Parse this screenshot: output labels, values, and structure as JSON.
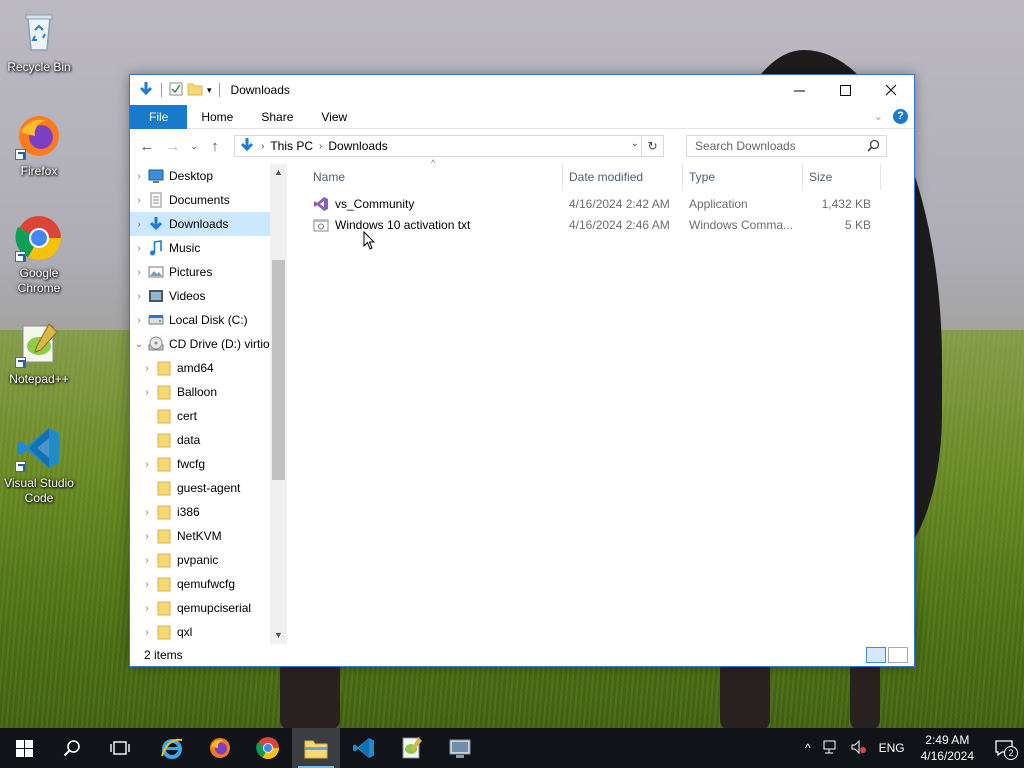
{
  "desktop": {
    "icons": [
      {
        "label": "Recycle Bin"
      },
      {
        "label": "Firefox"
      },
      {
        "label": "Google Chrome"
      },
      {
        "label": "Notepad++"
      },
      {
        "label": "Visual Studio Code"
      }
    ]
  },
  "window": {
    "title": "Downloads",
    "ribbon_tabs": [
      "File",
      "Home",
      "Share",
      "View"
    ],
    "breadcrumb": [
      "This PC",
      "Downloads"
    ],
    "search_placeholder": "Search Downloads",
    "nav_items": [
      {
        "label": "Desktop",
        "icon": "desktop-icon"
      },
      {
        "label": "Documents",
        "icon": "documents-icon"
      },
      {
        "label": "Downloads",
        "icon": "download-arrow-icon",
        "selected": true
      },
      {
        "label": "Music",
        "icon": "music-note-icon"
      },
      {
        "label": "Pictures",
        "icon": "pictures-icon"
      },
      {
        "label": "Videos",
        "icon": "videos-icon"
      },
      {
        "label": "Local Disk (C:)",
        "icon": "drive-icon"
      },
      {
        "label": "CD Drive (D:) virtio-win",
        "icon": "cd-drive-icon",
        "expanded": true
      },
      {
        "label": "amd64",
        "icon": "folder-icon"
      },
      {
        "label": "Balloon",
        "icon": "folder-icon"
      },
      {
        "label": "cert",
        "icon": "folder-icon"
      },
      {
        "label": "data",
        "icon": "folder-icon"
      },
      {
        "label": "fwcfg",
        "icon": "folder-icon"
      },
      {
        "label": "guest-agent",
        "icon": "folder-icon"
      },
      {
        "label": "i386",
        "icon": "folder-icon"
      },
      {
        "label": "NetKVM",
        "icon": "folder-icon"
      },
      {
        "label": "pvpanic",
        "icon": "folder-icon"
      },
      {
        "label": "qemufwcfg",
        "icon": "folder-icon"
      },
      {
        "label": "qemupciserial",
        "icon": "folder-icon"
      },
      {
        "label": "qxl",
        "icon": "folder-icon"
      }
    ],
    "columns": {
      "name": "Name",
      "date": "Date modified",
      "type": "Type",
      "size": "Size"
    },
    "files": [
      {
        "name": "vs_Community",
        "date": "4/16/2024 2:42 AM",
        "type": "Application",
        "size": "1,432 KB",
        "icon": "visual-studio-installer-icon"
      },
      {
        "name": "Windows 10 activation txt",
        "date": "4/16/2024 2:46 AM",
        "type": "Windows Comma...",
        "size": "5 KB",
        "icon": "cmd-script-icon"
      }
    ],
    "status": "2 items"
  },
  "taskbar": {
    "apps": [
      "start",
      "search",
      "task-view",
      "internet-explorer",
      "firefox",
      "chrome",
      "file-explorer",
      "vscode",
      "notepad-plus-plus",
      "control-panel"
    ],
    "language": "ENG",
    "time": "2:49 AM",
    "date": "4/16/2024",
    "notification_count": "2"
  },
  "colors": {
    "accent": "#1979ca",
    "selection": "#cce8ff",
    "taskbar": "#101317"
  }
}
